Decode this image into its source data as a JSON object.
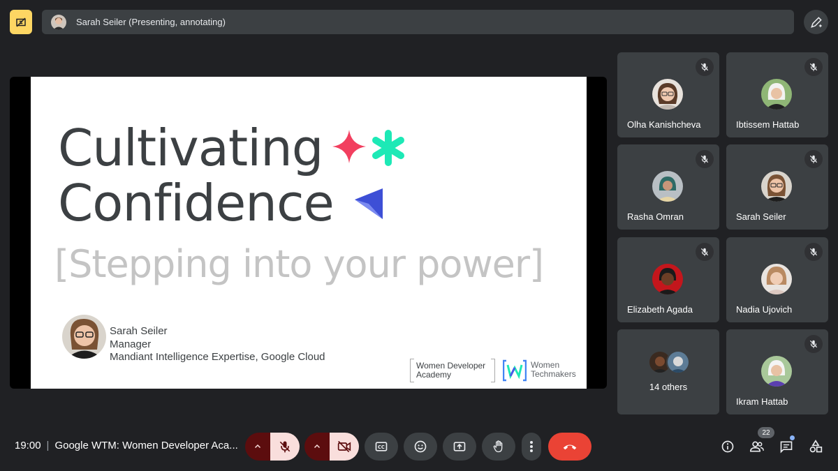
{
  "top_bar": {
    "presenter_text": "Sarah Seiler (Presenting, annotating)",
    "pin_icon": "pin-off-icon",
    "annotate_icon": "pen-sparkle-icon"
  },
  "slide": {
    "title_line1": "Cultivating",
    "title_line2": "Confidence",
    "subtitle": "[Stepping into your power]",
    "speaker_name": "Sarah Seiler",
    "speaker_title": "Manager",
    "speaker_org": "Mandiant Intelligence Expertise, Google Cloud",
    "logo1_line1": "Women Developer",
    "logo1_line2": "Academy",
    "logo2_line1": "Women",
    "logo2_line2": "Techmakers",
    "colors": {
      "spark_pink": "#f23f5f",
      "spark_teal": "#1de9b6",
      "spark_blue": "#4a5ae8"
    }
  },
  "participants": [
    {
      "name": "Olha Kanishcheva",
      "muted": true
    },
    {
      "name": "Ibtissem Hattab",
      "muted": true
    },
    {
      "name": "Rasha Omran",
      "muted": true
    },
    {
      "name": "Sarah Seiler",
      "muted": true
    },
    {
      "name": "Elizabeth Agada",
      "muted": true
    },
    {
      "name": "Nadia Ujovich",
      "muted": true
    },
    {
      "others_label": "14 others"
    },
    {
      "name": "Ikram Hattab",
      "muted": true
    }
  ],
  "bottom_bar": {
    "time": "19:00",
    "meeting_title": "Google WTM: Women Developer Aca...",
    "participant_count": "22",
    "icons": [
      "chevron-up-icon",
      "mic-off-icon",
      "chevron-up-icon",
      "camera-off-icon",
      "captions-icon",
      "emoji-icon",
      "present-screen-icon",
      "raise-hand-icon",
      "more-vert-icon",
      "end-call-icon",
      "info-icon",
      "people-icon",
      "chat-icon",
      "activities-icon"
    ],
    "colors": {
      "end_call": "#ea4335",
      "muted_bg": "#f9dedc",
      "muted_chevron": "#5c0d0e"
    }
  }
}
